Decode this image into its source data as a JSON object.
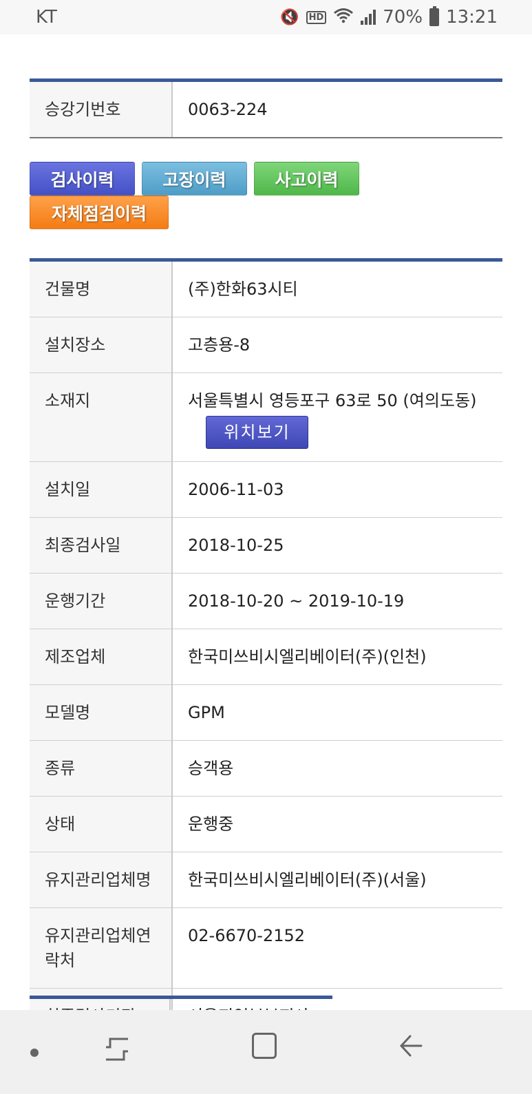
{
  "status": {
    "carrier": "KT",
    "battery": "70%",
    "time": "13:21"
  },
  "header_table": {
    "label": "승강기번호",
    "value": "0063-224"
  },
  "tabs": [
    {
      "label": "검사이력",
      "color": "#4451c6"
    },
    {
      "label": "고장이력",
      "color": "#4e9dc7"
    },
    {
      "label": "사고이력",
      "color": "#50b74a"
    },
    {
      "label": "자체점검이력",
      "color": "#f47c14"
    }
  ],
  "details": {
    "building_label": "건물명",
    "building_value": "(주)한화63시티",
    "install_place_label": "설치장소",
    "install_place_value": "고층용-8",
    "address_label": "소재지",
    "address_value": "서울특별시 영등포구 63로 50 (여의도동)",
    "location_button": "위치보기",
    "install_date_label": "설치일",
    "install_date_value": "2006-11-03",
    "last_inspection_label": "최종검사일",
    "last_inspection_value": "2018-10-25",
    "operation_period_label": "운행기간",
    "operation_period_value": "2018-10-20 ~ 2019-10-19",
    "manufacturer_label": "제조업체",
    "manufacturer_value": "한국미쓰비시엘리베이터(주)(인천)",
    "model_label": "모델명",
    "model_value": "GPM",
    "type_label": "종류",
    "type_value": "승객용",
    "state_label": "상태",
    "state_value": "운행중",
    "maintenance_company_label": "유지관리업체명",
    "maintenance_company_value": "한국미쓰비시엘리베이터(주)(서울)",
    "maintenance_contact_label": "유지관리업체연락처",
    "maintenance_contact_value": "02-6670-2152",
    "inspection_agency_label": "최종검사기관",
    "inspection_agency_value": "서울지역본부지사"
  },
  "accent_color": "#3b5998"
}
